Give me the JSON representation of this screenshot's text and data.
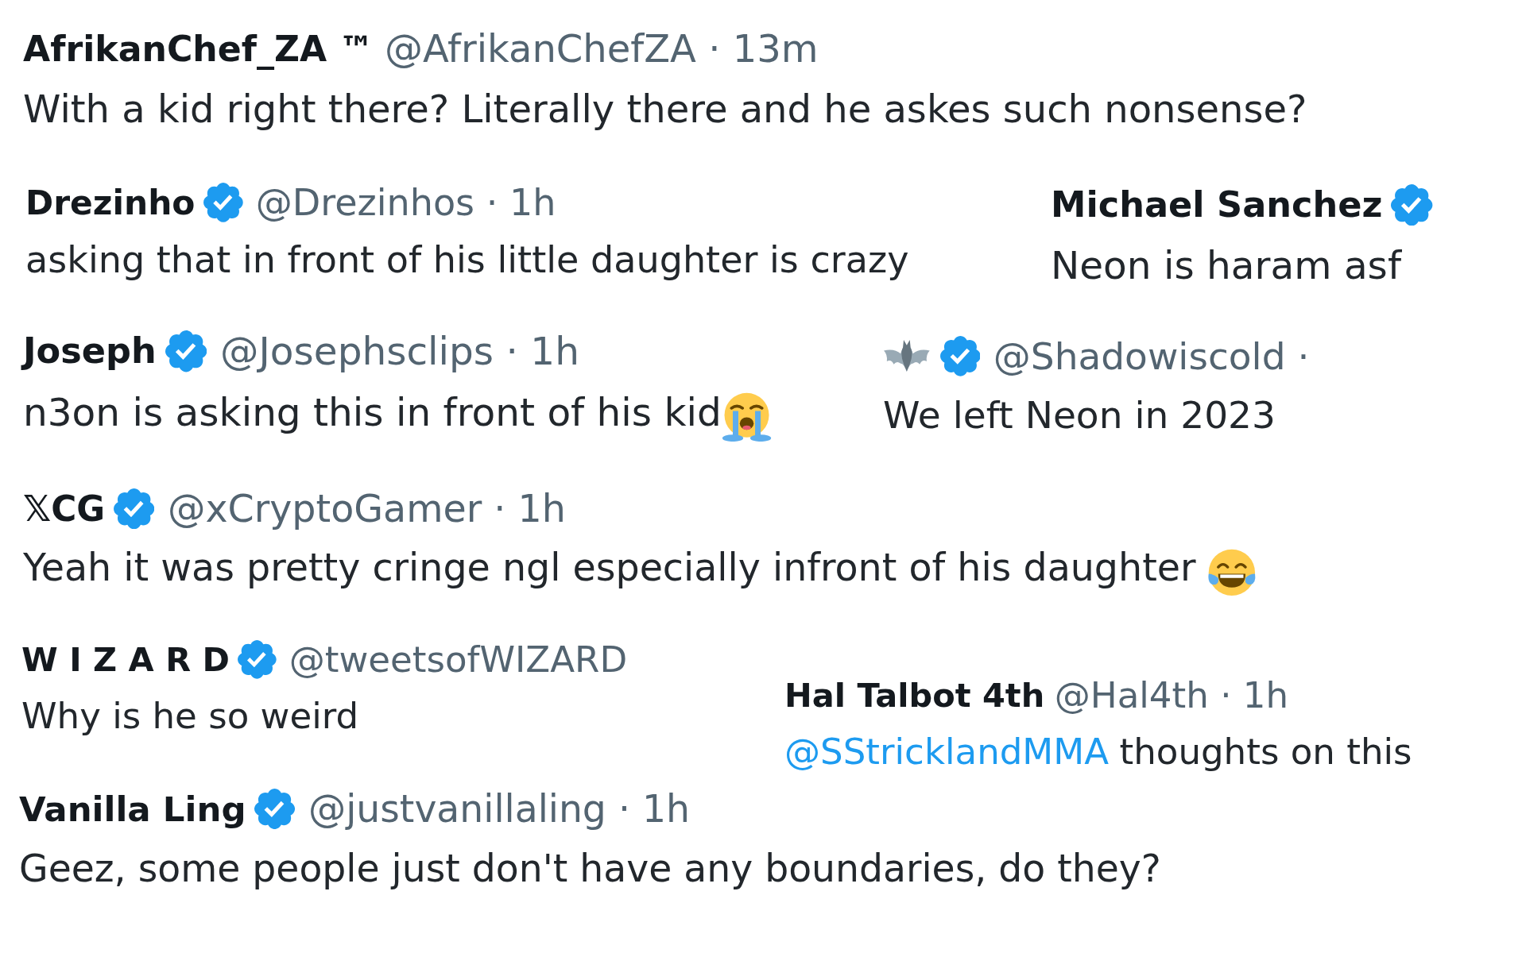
{
  "tweets": [
    {
      "name": "AfrikanChef_ZA ™",
      "verified": false,
      "handle_time": "@AfrikanChefZA · 13m",
      "text": "With a kid right there? Literally there and he askes such nonsense?"
    },
    {
      "name": "Drezinho",
      "verified": true,
      "handle_time": "@Drezinhos · 1h",
      "text": "asking that in front of his little daughter is crazy"
    },
    {
      "name": "Michael Sanchez",
      "verified": true,
      "text": "Neon is haram asf"
    },
    {
      "name": "Joseph",
      "verified": true,
      "handle_time": "@Josephsclips · 1h",
      "text": "n3on is asking this in front of his kid",
      "emoji": {
        "kind": "crying"
      }
    },
    {
      "name_emoji": {
        "kind": "bat"
      },
      "verified": true,
      "handle_time": "@Shadowiscold ·",
      "text": "We left Neon in 2023"
    },
    {
      "name": "𝕏CG",
      "verified": true,
      "handle_time": "@xCryptoGamer · 1h",
      "text": "Yeah it was pretty cringe ngl especially infront of his daughter",
      "emoji": {
        "kind": "laughing"
      }
    },
    {
      "name": "W I Z A R D",
      "verified": true,
      "handle_time": "@tweetsofWIZARD",
      "text": "Why is he so weird"
    },
    {
      "name": "Hal Talbot 4th",
      "verified": false,
      "handle_time": "@Hal4th · 1h",
      "mention": "@SStricklandMMA",
      "text": "thoughts on this"
    },
    {
      "name": "Vanilla Ling",
      "verified": true,
      "handle_time": "@justvanillaling · 1h",
      "text": "Geez, some people just don't have any boundaries, do they?"
    }
  ]
}
